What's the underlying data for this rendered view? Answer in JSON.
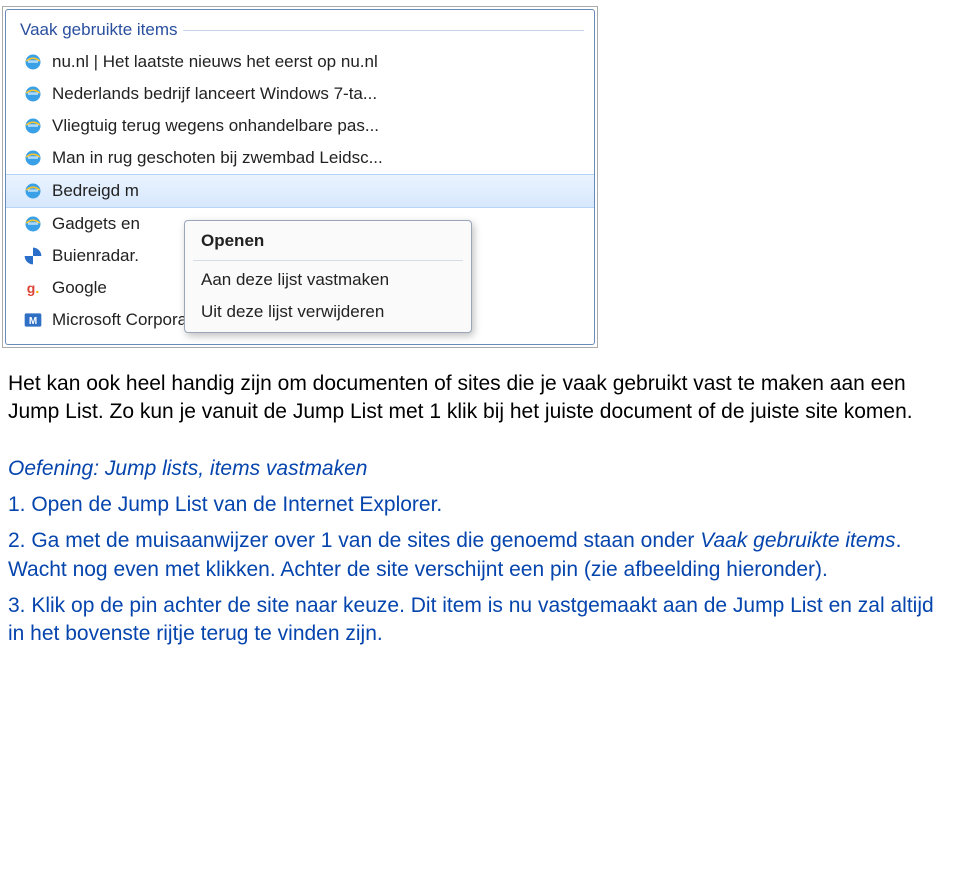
{
  "screenshot": {
    "section_header": "Vaak gebruikte items",
    "items": [
      {
        "icon": "ie",
        "label": "nu.nl | Het laatste nieuws het eerst op nu.nl"
      },
      {
        "icon": "ie",
        "label": "Nederlands bedrijf lanceert Windows 7-ta..."
      },
      {
        "icon": "ie",
        "label": "Vliegtuig terug wegens onhandelbare pas..."
      },
      {
        "icon": "ie",
        "label": "Man in rug geschoten bij zwembad Leidsc..."
      },
      {
        "icon": "ie",
        "label": "Bedreigd m",
        "highlight": true
      },
      {
        "icon": "ie",
        "label": "Gadgets en"
      },
      {
        "icon": "buienradar",
        "label": "Buienradar."
      },
      {
        "icon": "google",
        "label": "Google"
      },
      {
        "icon": "ms",
        "label": "Microsoft Corporation"
      }
    ],
    "context_menu": {
      "open": "Openen",
      "pin": "Aan deze lijst vastmaken",
      "remove": "Uit deze lijst verwijderen"
    }
  },
  "body": {
    "p1": "Het kan ook heel handig zijn om documenten of sites die je vaak gebruikt vast te maken aan een Jump List. Zo kun je vanuit de Jump List met 1 klik bij het juiste document of de juiste site komen.",
    "exercise_title": "Oefening: Jump lists, items vastmaken",
    "step1": "1. Open de Jump List van de Internet Explorer.",
    "step2a": "2. Ga met de muisaanwijzer over 1 van de sites die genoemd staan onder ",
    "step2_term": "Vaak gebruikte items",
    "step2b": ". Wacht nog even met klikken. Achter de site verschijnt een pin (zie afbeelding hieronder).",
    "step3": "3. Klik op de pin achter de site naar keuze. Dit item is nu vastgemaakt aan de Jump List en zal altijd in het bovenste rijtje terug te vinden zijn."
  }
}
